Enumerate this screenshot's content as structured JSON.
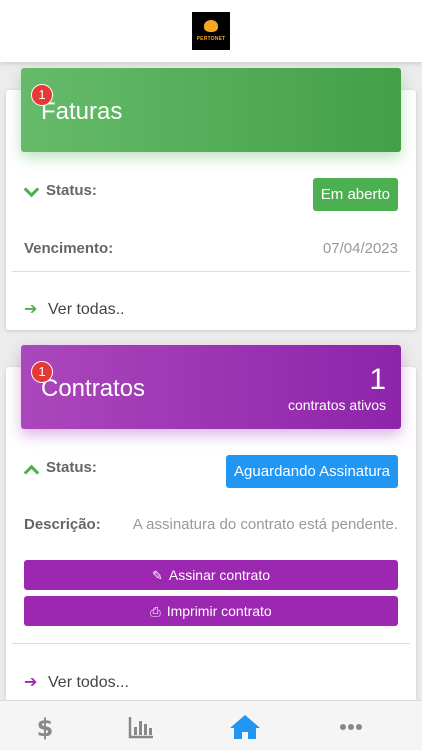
{
  "logo": {
    "text": "PERTONET"
  },
  "faturas": {
    "title": "Faturas",
    "notification_count": "1",
    "status_label": "Status:",
    "status_value": "Em aberto",
    "vencimento_label": "Vencimento:",
    "vencimento_value": "07/04/2023",
    "link_label": "Ver todas.."
  },
  "contratos": {
    "title": "Contratos",
    "notification_count": "1",
    "count": "1",
    "count_label": "contratos ativos",
    "status_label": "Status:",
    "status_value": "Aguardando Assinatura",
    "descricao_label": "Descrição:",
    "descricao_value": "A assinatura do contrato está pendente.",
    "sign_button": "Assinar contrato",
    "print_button": "Imprimir contrato",
    "link_label": "Ver todos..."
  },
  "colors": {
    "green": "#4caf50",
    "purple": "#9c27b0",
    "blue": "#2196f3",
    "red": "#e53935"
  },
  "nav": {
    "items": [
      {
        "icon": "dollar-icon",
        "active": false
      },
      {
        "icon": "bar-chart-icon",
        "active": false
      },
      {
        "icon": "home-icon",
        "active": true
      },
      {
        "icon": "more-icon",
        "active": false
      }
    ]
  }
}
